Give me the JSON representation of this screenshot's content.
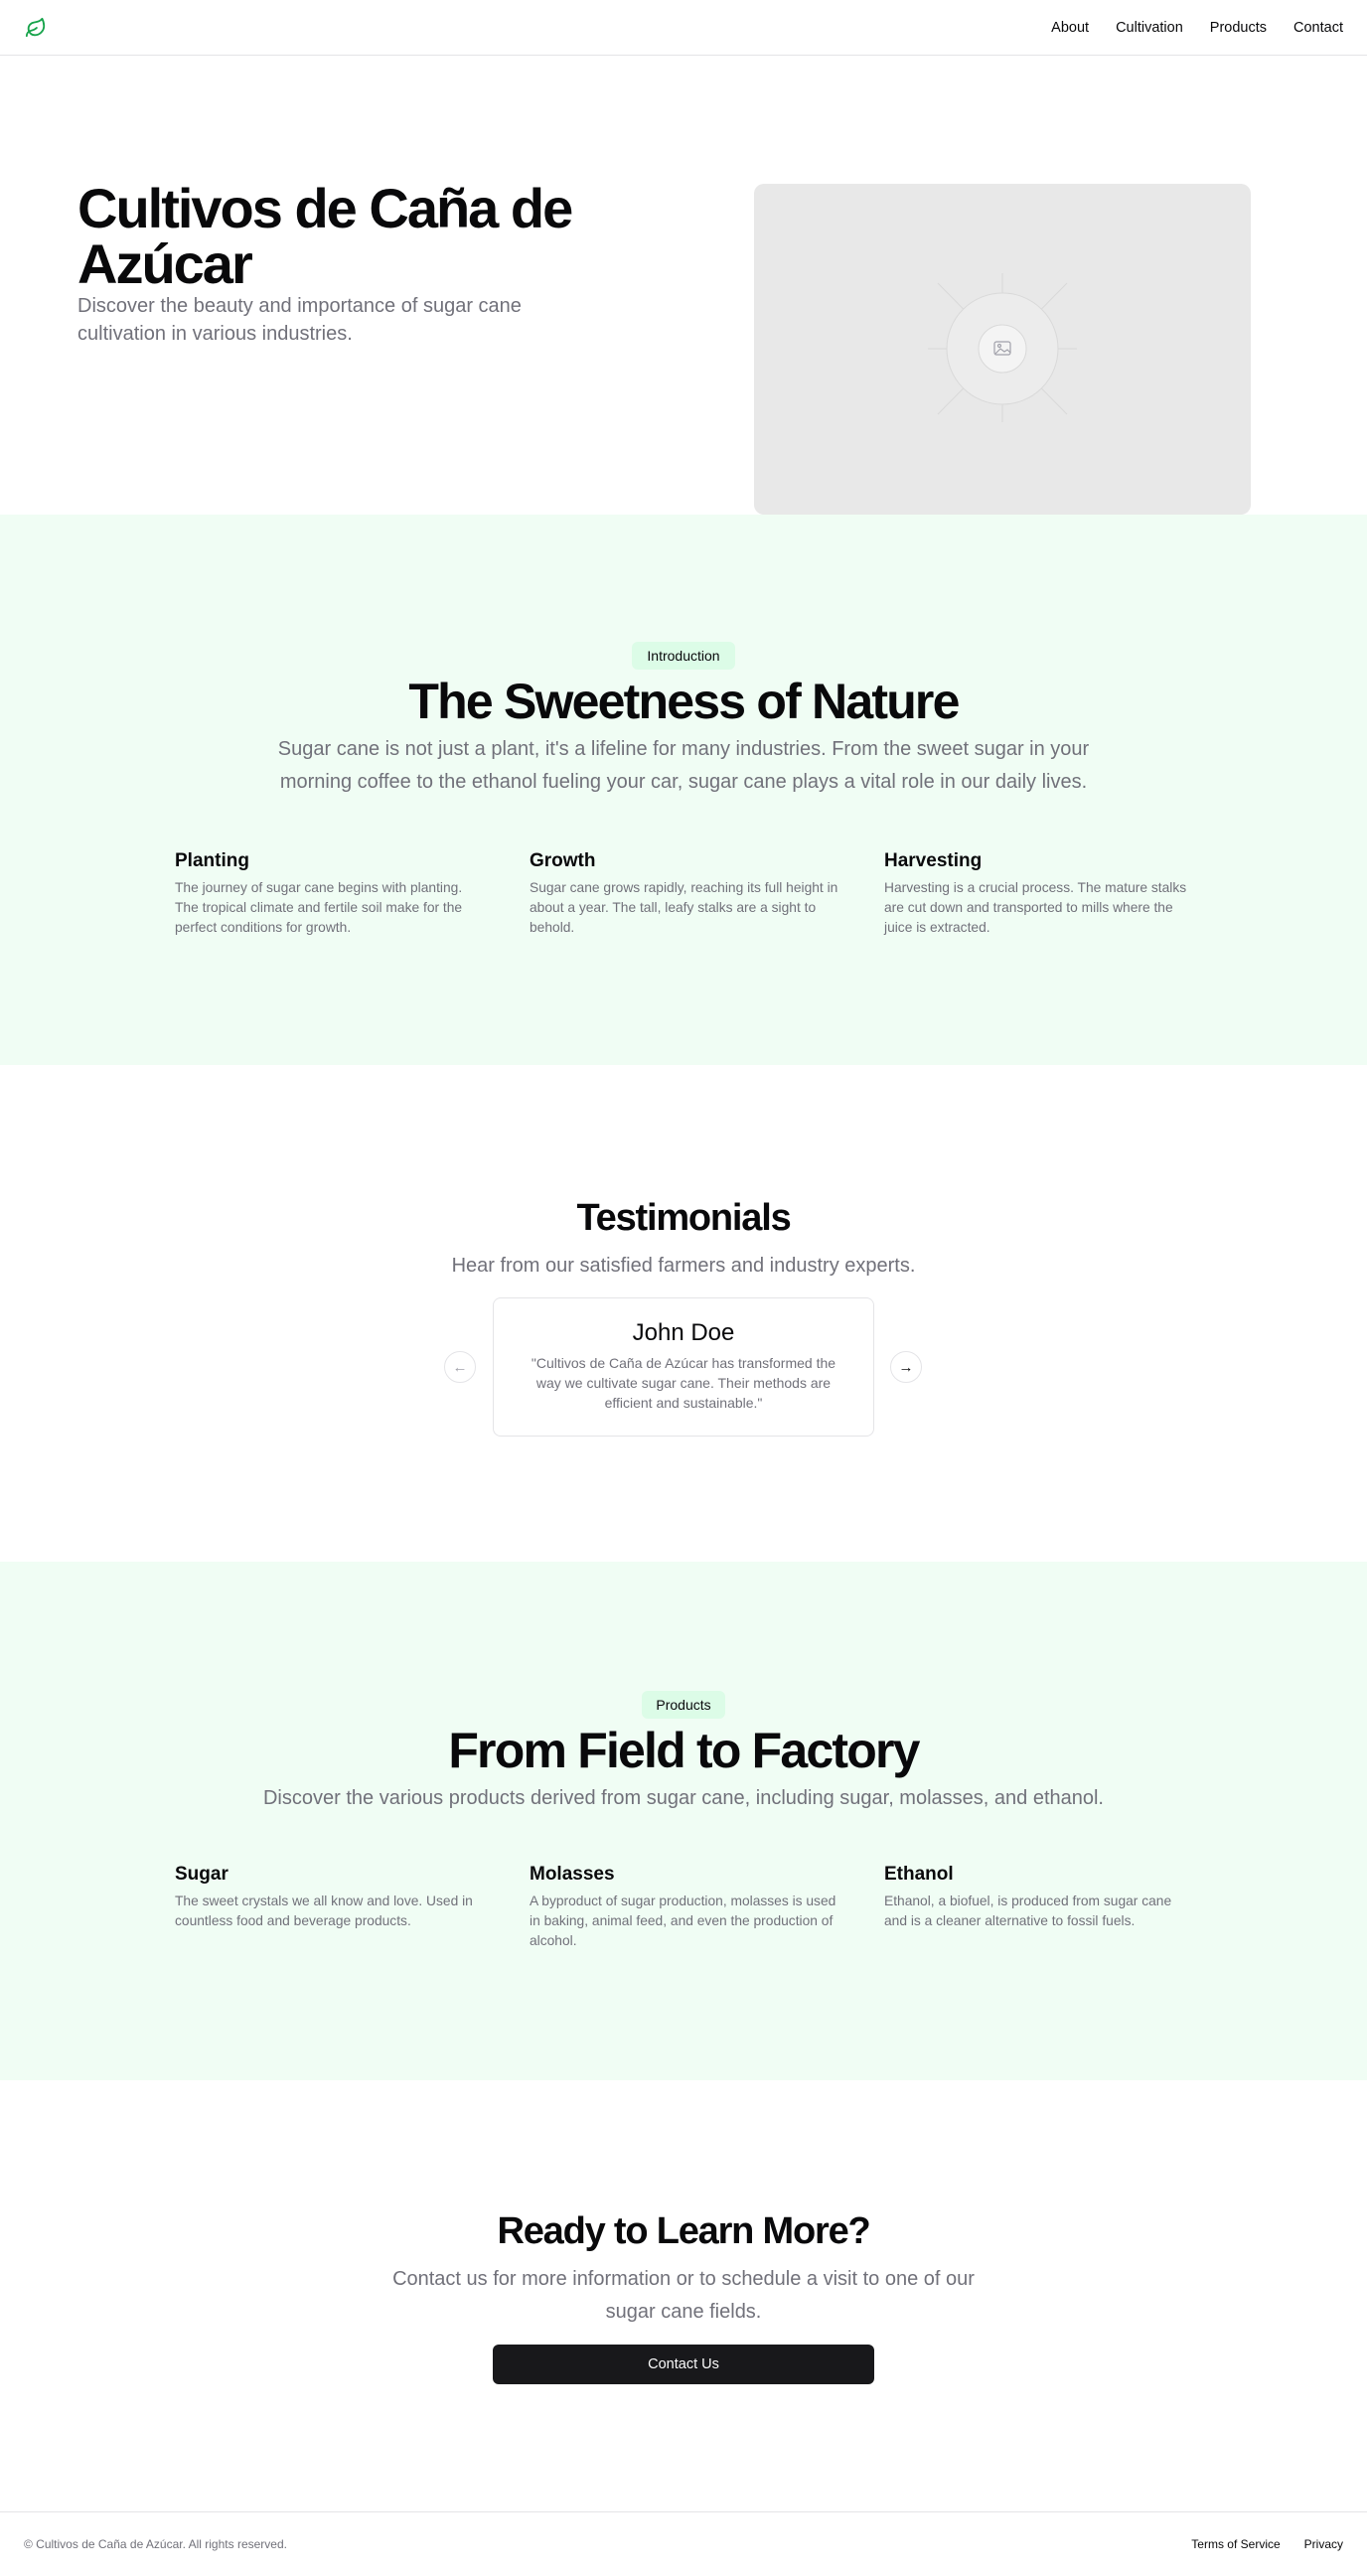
{
  "nav": {
    "items": [
      "About",
      "Cultivation",
      "Products",
      "Contact"
    ]
  },
  "hero": {
    "title": "Cultivos de Caña de Azúcar",
    "subtitle": "Discover the beauty and importance of sugar cane cultivation in various industries."
  },
  "intro": {
    "badge": "Introduction",
    "title": "The Sweetness of Nature",
    "subtitle": "Sugar cane is not just a plant, it's a lifeline for many industries. From the sweet sugar in your morning coffee to the ethanol fueling your car, sugar cane plays a vital role in our daily lives.",
    "features": [
      {
        "title": "Planting",
        "text": "The journey of sugar cane begins with planting. The tropical climate and fertile soil make for the perfect conditions for growth."
      },
      {
        "title": "Growth",
        "text": "Sugar cane grows rapidly, reaching its full height in about a year. The tall, leafy stalks are a sight to behold."
      },
      {
        "title": "Harvesting",
        "text": "Harvesting is a crucial process. The mature stalks are cut down and transported to mills where the juice is extracted."
      }
    ]
  },
  "testimonials": {
    "title": "Testimonials",
    "subtitle": "Hear from our satisfied farmers and industry experts.",
    "card": {
      "name": "John Doe",
      "quote": "\"Cultivos de Caña de Azúcar has transformed the way we cultivate sugar cane. Their methods are efficient and sustainable.\""
    }
  },
  "products": {
    "badge": "Products",
    "title": "From Field to Factory",
    "subtitle": "Discover the various products derived from sugar cane, including sugar, molasses, and ethanol.",
    "items": [
      {
        "title": "Sugar",
        "text": "The sweet crystals we all know and love. Used in countless food and beverage products."
      },
      {
        "title": "Molasses",
        "text": "A byproduct of sugar production, molasses is used in baking, animal feed, and even the production of alcohol."
      },
      {
        "title": "Ethanol",
        "text": "Ethanol, a biofuel, is produced from sugar cane and is a cleaner alternative to fossil fuels."
      }
    ]
  },
  "cta": {
    "title": "Ready to Learn More?",
    "subtitle": "Contact us for more information or to schedule a visit to one of our sugar cane fields.",
    "button": "Contact Us"
  },
  "footer": {
    "copyright": "© Cultivos de Caña de Azúcar. All rights reserved.",
    "links": [
      "Terms of Service",
      "Privacy"
    ]
  },
  "colors": {
    "accent_green": "#16a34a",
    "section_bg": "#f0fdf4",
    "badge_bg": "#dcfce7",
    "button_dark": "#18181b"
  }
}
